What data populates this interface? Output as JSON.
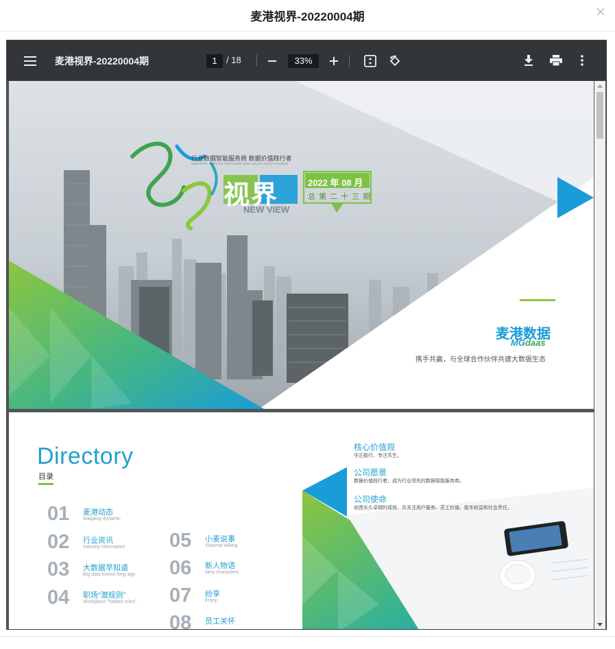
{
  "modal": {
    "title": "麦港视界-20220004期",
    "close_icon": "close-icon"
  },
  "viewer": {
    "doc_title": "麦港视界-20220004期",
    "current_page": "1",
    "page_total": "/ 18",
    "zoom": "33%",
    "icons": [
      "menu-icon",
      "zoom-out-icon",
      "zoom-in-icon",
      "fit-page-icon",
      "rotate-icon",
      "download-icon",
      "print-icon",
      "more-options-icon"
    ]
  },
  "page1": {
    "tagline_cn": "行业数据智能服务商 数据价值践行者",
    "tagline_en": "INDUSTRY SERVICE PROVIDER  DATA VALUE PRACTITIONER",
    "logo_calligraphy": "麦港",
    "logo_shijie": "视界",
    "new_view": "NEW VIEW",
    "issue_date": "2022 年 08 月",
    "issue_no": "总 第 二 十 三 期",
    "brand_cn": "麦港数据",
    "brand_en_mg": "MG",
    "brand_en_daas": "daas",
    "slogan": "携手共赢，与全球合作伙伴共建大数据生态",
    "colors": {
      "green": "#7dc242",
      "blue": "#1a9cd8",
      "teal": "#23b3a6"
    }
  },
  "page2": {
    "directory_title": "Directory",
    "directory_cn": "目录",
    "items_left": [
      {
        "num": "01",
        "title": "麦港动态",
        "sub": "Maigang dynamic"
      },
      {
        "num": "02",
        "title": "行业资讯",
        "sub": "Industry information"
      },
      {
        "num": "03",
        "title": "大数据早知道",
        "sub": "Big data knows long ago"
      },
      {
        "num": "04",
        "title": "职场“潜规则”",
        "sub": "Workplace \"hidden rules\""
      }
    ],
    "items_right": [
      {
        "num": "05",
        "title": "小麦说事",
        "sub": "Xiaomai talking"
      },
      {
        "num": "06",
        "title": "新人物语",
        "sub": "New characters"
      },
      {
        "num": "07",
        "title": "纷享",
        "sub": "Enjoy"
      },
      {
        "num": "08",
        "title": "员工关怀",
        "sub": ""
      }
    ],
    "values": [
      {
        "title": "核心价值观",
        "desc": "守正毅行、专注共生。"
      },
      {
        "title": "公司愿景",
        "desc": "数据价值践行者，成为行业领先的数据智能服务商。"
      },
      {
        "title": "公司使命",
        "desc": "创造长久卓越的成就，并关注用户服务、员工价值、股东权益和社会责任。"
      }
    ]
  }
}
